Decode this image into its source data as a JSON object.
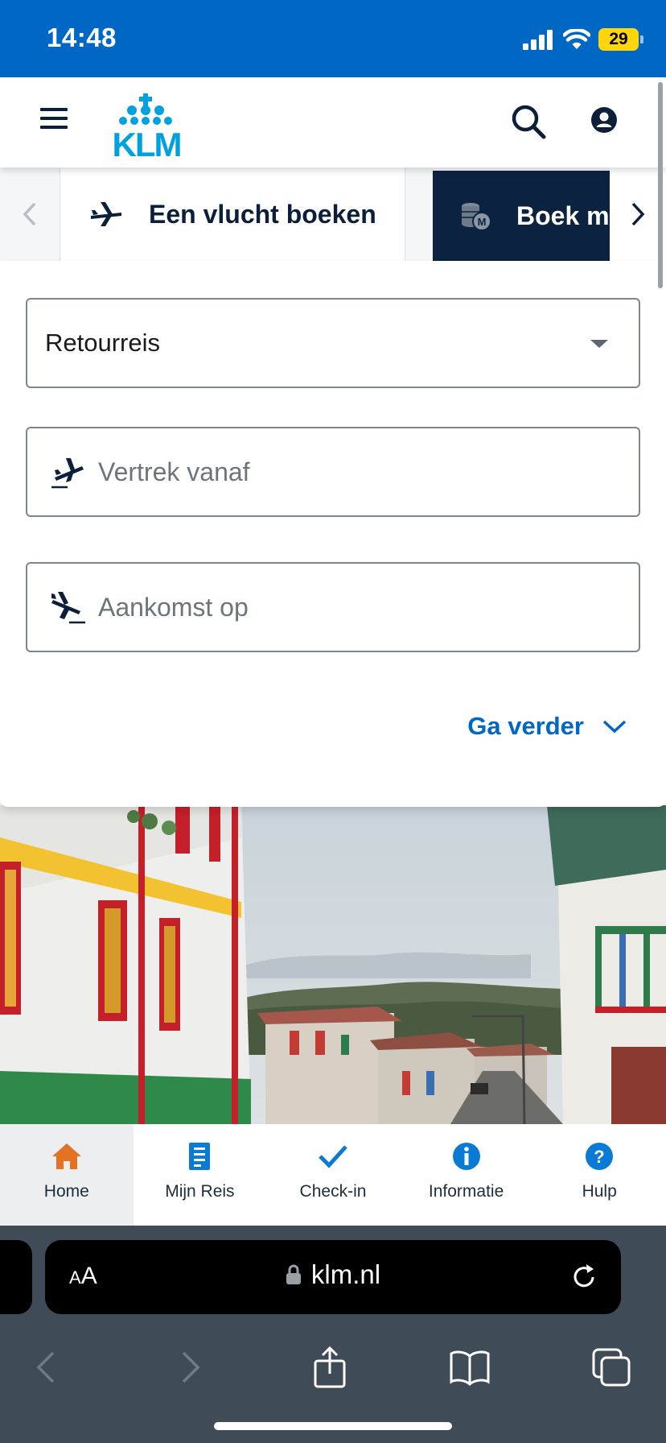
{
  "status_bar": {
    "time": "14:48",
    "battery": "29"
  },
  "header": {
    "logo_text": "KLM",
    "brand_color": "#00a1de"
  },
  "tabs": {
    "items": [
      {
        "label": "Een vlucht boeken",
        "icon": "airplane-icon",
        "active": false
      },
      {
        "label": "Boek m",
        "icon": "miles-coins-icon",
        "active": true
      }
    ]
  },
  "booking": {
    "trip_type": "Retourreis",
    "from_placeholder": "Vertrek vanaf",
    "to_placeholder": "Aankomst op",
    "continue_label": "Ga verder"
  },
  "bottom_nav": {
    "items": [
      {
        "label": "Home",
        "icon": "home-icon",
        "active": true
      },
      {
        "label": "Mijn Reis",
        "icon": "trip-document-icon",
        "active": false
      },
      {
        "label": "Check-in",
        "icon": "checkmark-icon",
        "active": false
      },
      {
        "label": "Informatie",
        "icon": "info-icon",
        "active": false
      },
      {
        "label": "Hulp",
        "icon": "help-icon",
        "active": false
      }
    ]
  },
  "browser": {
    "aa_small": "A",
    "aa_big": "A",
    "url": "klm.nl"
  },
  "colors": {
    "status_bar": "#0067c5",
    "active_tab": "#0b2340",
    "link_blue": "#0067c5",
    "home_orange": "#e37222",
    "nav_blue": "#0a7bd4"
  }
}
